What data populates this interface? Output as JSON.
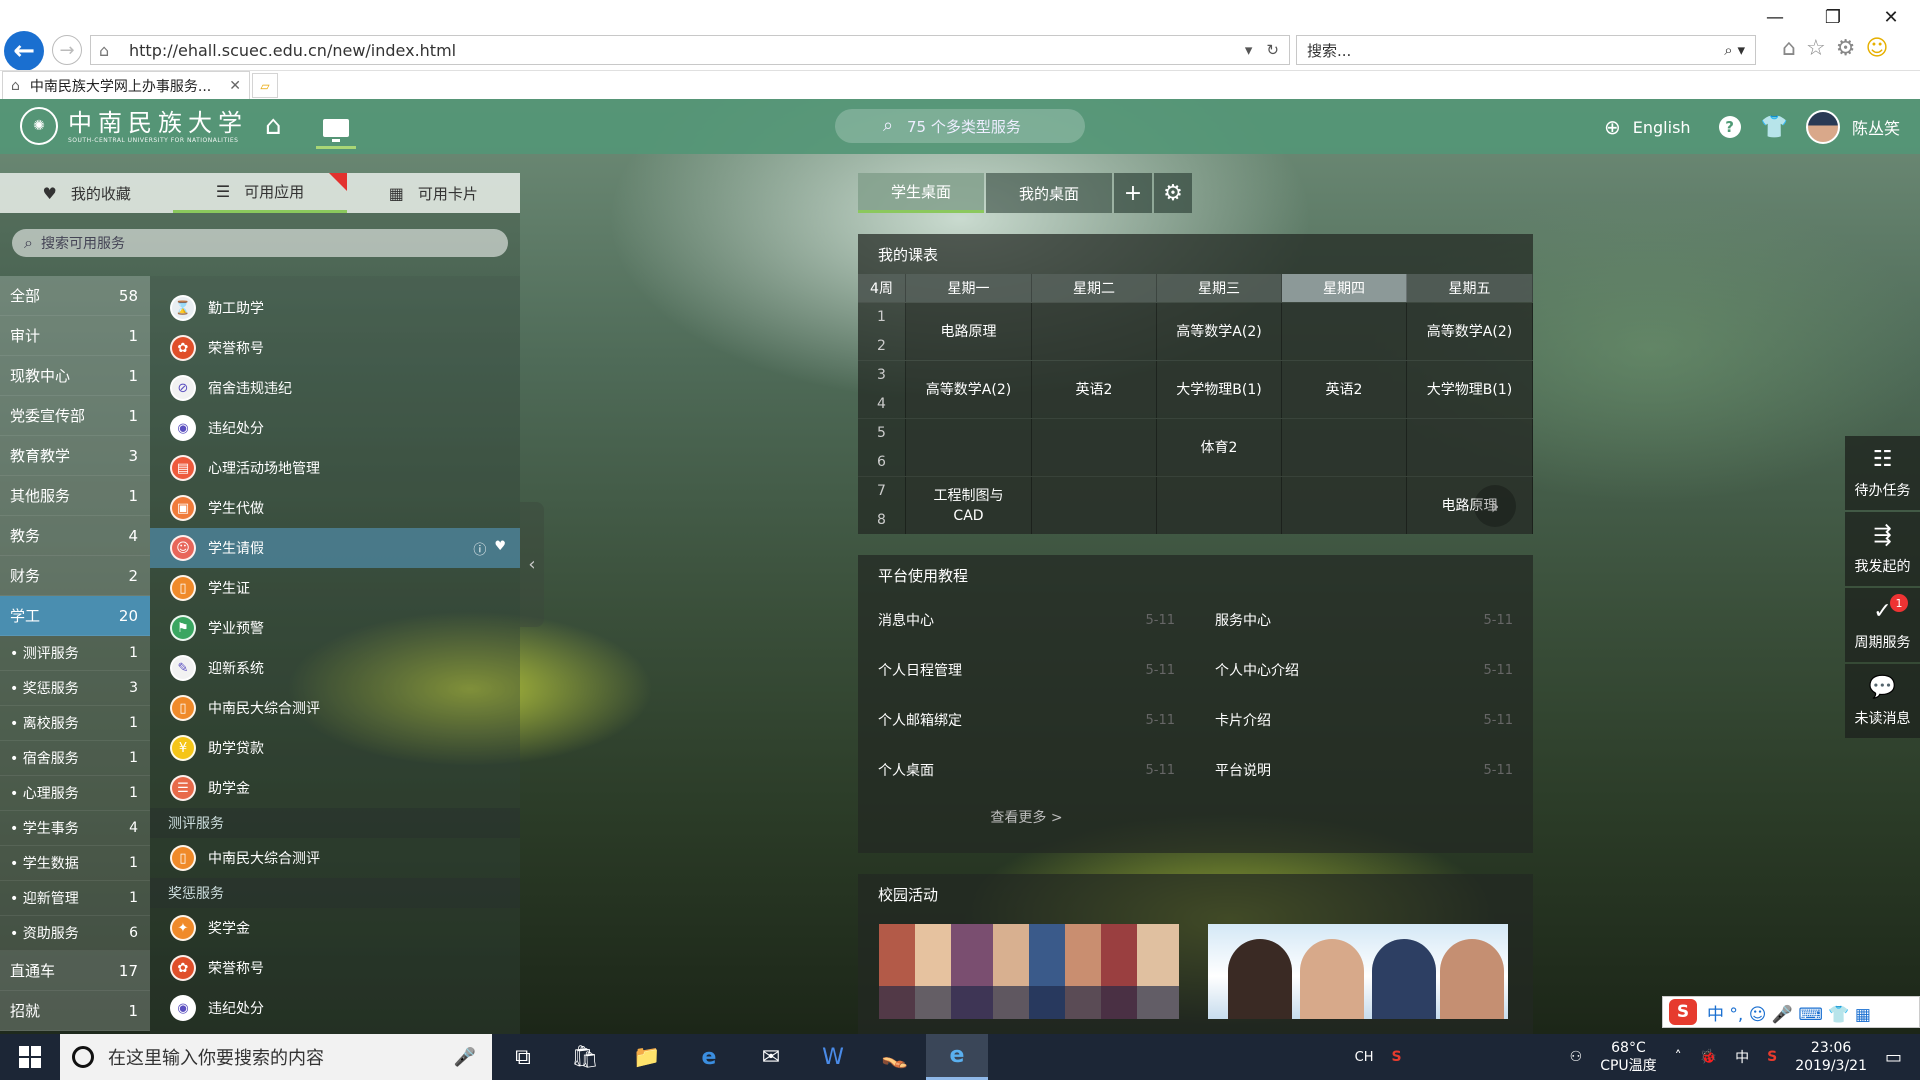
{
  "browser": {
    "url": "http://ehall.scuec.edu.cn/new/index.html",
    "search_placeholder": "搜索...",
    "tab_title": "中南民族大学网上办事服务...",
    "win_min": "—",
    "win_max": "❐",
    "win_close": "✕"
  },
  "header": {
    "logo_name": "中南民族大学",
    "logo_sub": "SOUTH-CENTRAL UNIVERSITY FOR NATIONALITIES",
    "search_text": "75 个多类型服务",
    "language": "English",
    "help": "?",
    "user_name": "陈丛笑"
  },
  "left_tabs": [
    {
      "label": "我的收藏",
      "icon": "♥"
    },
    {
      "label": "可用应用",
      "icon": "☰"
    },
    {
      "label": "可用卡片",
      "icon": "▦"
    }
  ],
  "left_search_placeholder": "搜索可用服务",
  "categories": [
    {
      "label": "全部",
      "count": "58"
    },
    {
      "label": "审计",
      "count": "1"
    },
    {
      "label": "现教中心",
      "count": "1"
    },
    {
      "label": "党委宣传部",
      "count": "1"
    },
    {
      "label": "教育教学",
      "count": "3"
    },
    {
      "label": "其他服务",
      "count": "1"
    },
    {
      "label": "教务",
      "count": "4"
    },
    {
      "label": "财务",
      "count": "2"
    },
    {
      "label": "学工",
      "count": "20"
    }
  ],
  "subcategories": [
    {
      "label": "测评服务",
      "count": "1"
    },
    {
      "label": "奖惩服务",
      "count": "3"
    },
    {
      "label": "离校服务",
      "count": "1"
    },
    {
      "label": "宿舍服务",
      "count": "1"
    },
    {
      "label": "心理服务",
      "count": "1"
    },
    {
      "label": "学生事务",
      "count": "4"
    },
    {
      "label": "学生数据",
      "count": "1"
    },
    {
      "label": "迎新管理",
      "count": "1"
    },
    {
      "label": "资助服务",
      "count": "6"
    }
  ],
  "categories_tail": [
    {
      "label": "直通车",
      "count": "17"
    },
    {
      "label": "招就",
      "count": "1"
    }
  ],
  "apps": [
    {
      "label": "勤工助学",
      "icon": "⌛",
      "color": "#e9eef2"
    },
    {
      "label": "荣誉称号",
      "icon": "✿",
      "color": "#e04f2a"
    },
    {
      "label": "宿舍违规违纪",
      "icon": "⊘",
      "color": "#f2f2f2"
    },
    {
      "label": "违纪处分",
      "icon": "◉",
      "color": "#ffffff"
    },
    {
      "label": "心理活动场地管理",
      "icon": "▤",
      "color": "#ee5a3c"
    },
    {
      "label": "学生代做",
      "icon": "▣",
      "color": "#f07b3a"
    },
    {
      "label": "学生请假",
      "icon": "☺",
      "color": "#e8665a"
    },
    {
      "label": "学生证",
      "icon": "▯",
      "color": "#f08a2a"
    },
    {
      "label": "学业预警",
      "icon": "⚑",
      "color": "#3aa661"
    },
    {
      "label": "迎新系统",
      "icon": "✎",
      "color": "#f2f2f2"
    },
    {
      "label": "中南民大综合测评",
      "icon": "▯",
      "color": "#f08a2a"
    },
    {
      "label": "助学贷款",
      "icon": "¥",
      "color": "#f5c518"
    },
    {
      "label": "助学金",
      "icon": "☰",
      "color": "#e86a4a"
    }
  ],
  "app_group_1": "测评服务",
  "apps_group_1": [
    {
      "label": "中南民大综合测评",
      "icon": "▯",
      "color": "#f08a2a"
    }
  ],
  "app_group_2": "奖惩服务",
  "apps_group_2": [
    {
      "label": "奖学金",
      "icon": "✦",
      "color": "#f08a2a"
    },
    {
      "label": "荣誉称号",
      "icon": "✿",
      "color": "#e04f2a"
    },
    {
      "label": "违纪处分",
      "icon": "◉",
      "color": "#ffffff"
    }
  ],
  "desk_tabs": [
    "学生桌面",
    "我的桌面"
  ],
  "timetable": {
    "title": "我的课表",
    "week": "4周",
    "days": [
      "星期一",
      "星期二",
      "星期三",
      "星期四",
      "星期五"
    ],
    "rows": [
      {
        "periods": [
          "1",
          "2"
        ],
        "cells": [
          "电路原理",
          "",
          "高等数学A(2)",
          "",
          "高等数学A(2)"
        ]
      },
      {
        "periods": [
          "3",
          "4"
        ],
        "cells": [
          "高等数学A(2)",
          "英语2",
          "大学物理B(1)",
          "英语2",
          "大学物理B(1)"
        ]
      },
      {
        "periods": [
          "5",
          "6"
        ],
        "cells": [
          "",
          "",
          "体育2",
          "",
          ""
        ]
      },
      {
        "periods": [
          "7",
          "8"
        ],
        "cells": [
          "工程制图与CAD",
          "",
          "",
          "",
          "电路原理"
        ]
      }
    ]
  },
  "tutorial": {
    "title": "平台使用教程",
    "items": [
      {
        "label": "消息中心",
        "date": "5-11"
      },
      {
        "label": "服务中心",
        "date": "5-11"
      },
      {
        "label": "个人日程管理",
        "date": "5-11"
      },
      {
        "label": "个人中心介绍",
        "date": "5-11"
      },
      {
        "label": "个人邮箱绑定",
        "date": "5-11"
      },
      {
        "label": "卡片介绍",
        "date": "5-11"
      },
      {
        "label": "个人桌面",
        "date": "5-11"
      },
      {
        "label": "平台说明",
        "date": "5-11"
      }
    ],
    "more": "查看更多 >"
  },
  "activities": {
    "title": "校园活动"
  },
  "dock": [
    {
      "label": "待办任务",
      "icon": "☷"
    },
    {
      "label": "我发起的",
      "icon": "⇶"
    },
    {
      "label": "周期服务",
      "icon": "✓",
      "badge": "1"
    },
    {
      "label": "未读消息",
      "icon": "💬"
    }
  ],
  "ime": {
    "logo": "S",
    "chars": "中 °, ☺ 🎤 ⌨ 👕 ▦"
  },
  "taskbar": {
    "search_placeholder": "在这里输入你要搜索的内容",
    "ime_label": "CH",
    "temp": "68°C",
    "temp_label": "CPU温度",
    "ime_lang": "中",
    "time": "23:06",
    "date": "2019/3/21"
  }
}
